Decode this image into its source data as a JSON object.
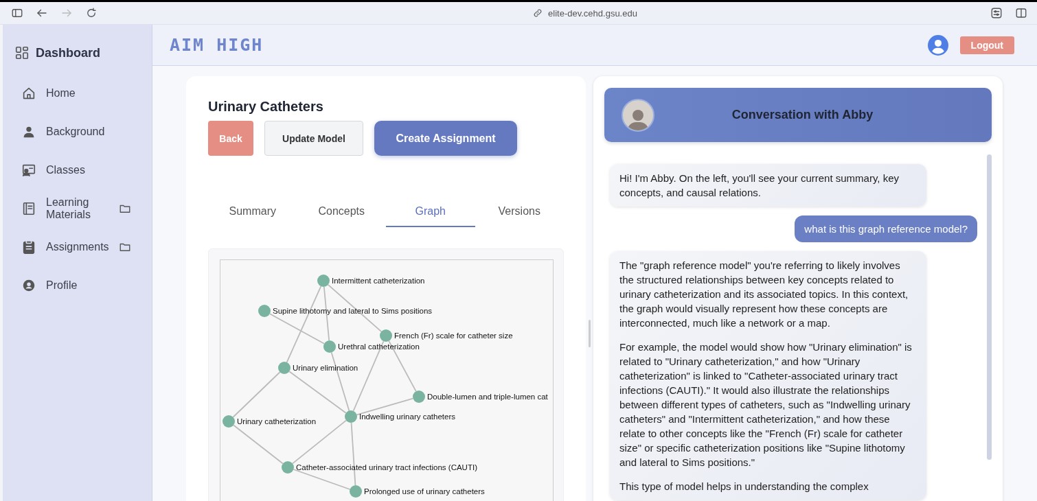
{
  "browser": {
    "url": "elite-dev.cehd.gsu.edu",
    "forward_disabled": true
  },
  "sidebar": {
    "title": "Dashboard",
    "items": [
      {
        "label": "Home",
        "has_folder": false
      },
      {
        "label": "Background",
        "has_folder": false
      },
      {
        "label": "Classes",
        "has_folder": false
      },
      {
        "label": "Learning Materials",
        "has_folder": true
      },
      {
        "label": "Assignments",
        "has_folder": true
      },
      {
        "label": "Profile",
        "has_folder": false
      }
    ]
  },
  "header": {
    "logo": "AIM HIGH",
    "logout": "Logout"
  },
  "model": {
    "title": "Urinary Catheters",
    "buttons": [
      {
        "label": "Back",
        "kind": "danger"
      },
      {
        "label": "Update Model",
        "kind": "secondary"
      },
      {
        "label": "Create Assignment",
        "kind": "primary"
      }
    ],
    "tabs": [
      {
        "label": "Summary",
        "selected": false
      },
      {
        "label": "Concepts",
        "selected": false
      },
      {
        "label": "Graph",
        "selected": true
      },
      {
        "label": "Versions",
        "selected": false
      }
    ],
    "graph": {
      "nodes": [
        "Intermittent catheterization",
        "Supine lithotomy and lateral to Sims positions",
        "French (Fr) scale for catheter size",
        "Urethral catheterization",
        "Urinary elimination",
        "Double-lumen and triple-lumen cat",
        "Indwelling urinary catheters",
        "Urinary catheterization",
        "Catheter-associated urinary tract infections (CAUTI)",
        "Prolonged use of urinary catheters"
      ]
    }
  },
  "chat": {
    "title": "Conversation with Abby",
    "messages": [
      {
        "kind": "assistant",
        "paragraphs": [
          "Hi! I'm Abby. On the left, you'll see your current summary, key concepts, and causal relations."
        ]
      },
      {
        "kind": "user",
        "paragraphs": [
          "what is this graph reference model?"
        ]
      },
      {
        "kind": "assistant",
        "paragraphs": [
          "The \"graph reference model\" you're referring to likely involves the structured relationships between key concepts related to urinary catheterization and its associated topics. In this context, the graph would visually represent how these concepts are interconnected, much like a network or a map.",
          "For example, the model would show how \"Urinary elimination\" is related to \"Urinary catheterization,\" and how \"Urinary catheterization\" is linked to \"Catheter-associated urinary tract infections (CAUTI).\" It would also illustrate the relationships between different types of catheters, such as \"Indwelling urinary catheters\" and \"Intermittent catheterization,\" and how these relate to other concepts like the \"French (Fr) scale for catheter size\" or specific catheterization positions like \"Supine lithotomy and lateral to Sims positions.\"",
          "This type of model helps in understanding the complex"
        ]
      }
    ]
  }
}
